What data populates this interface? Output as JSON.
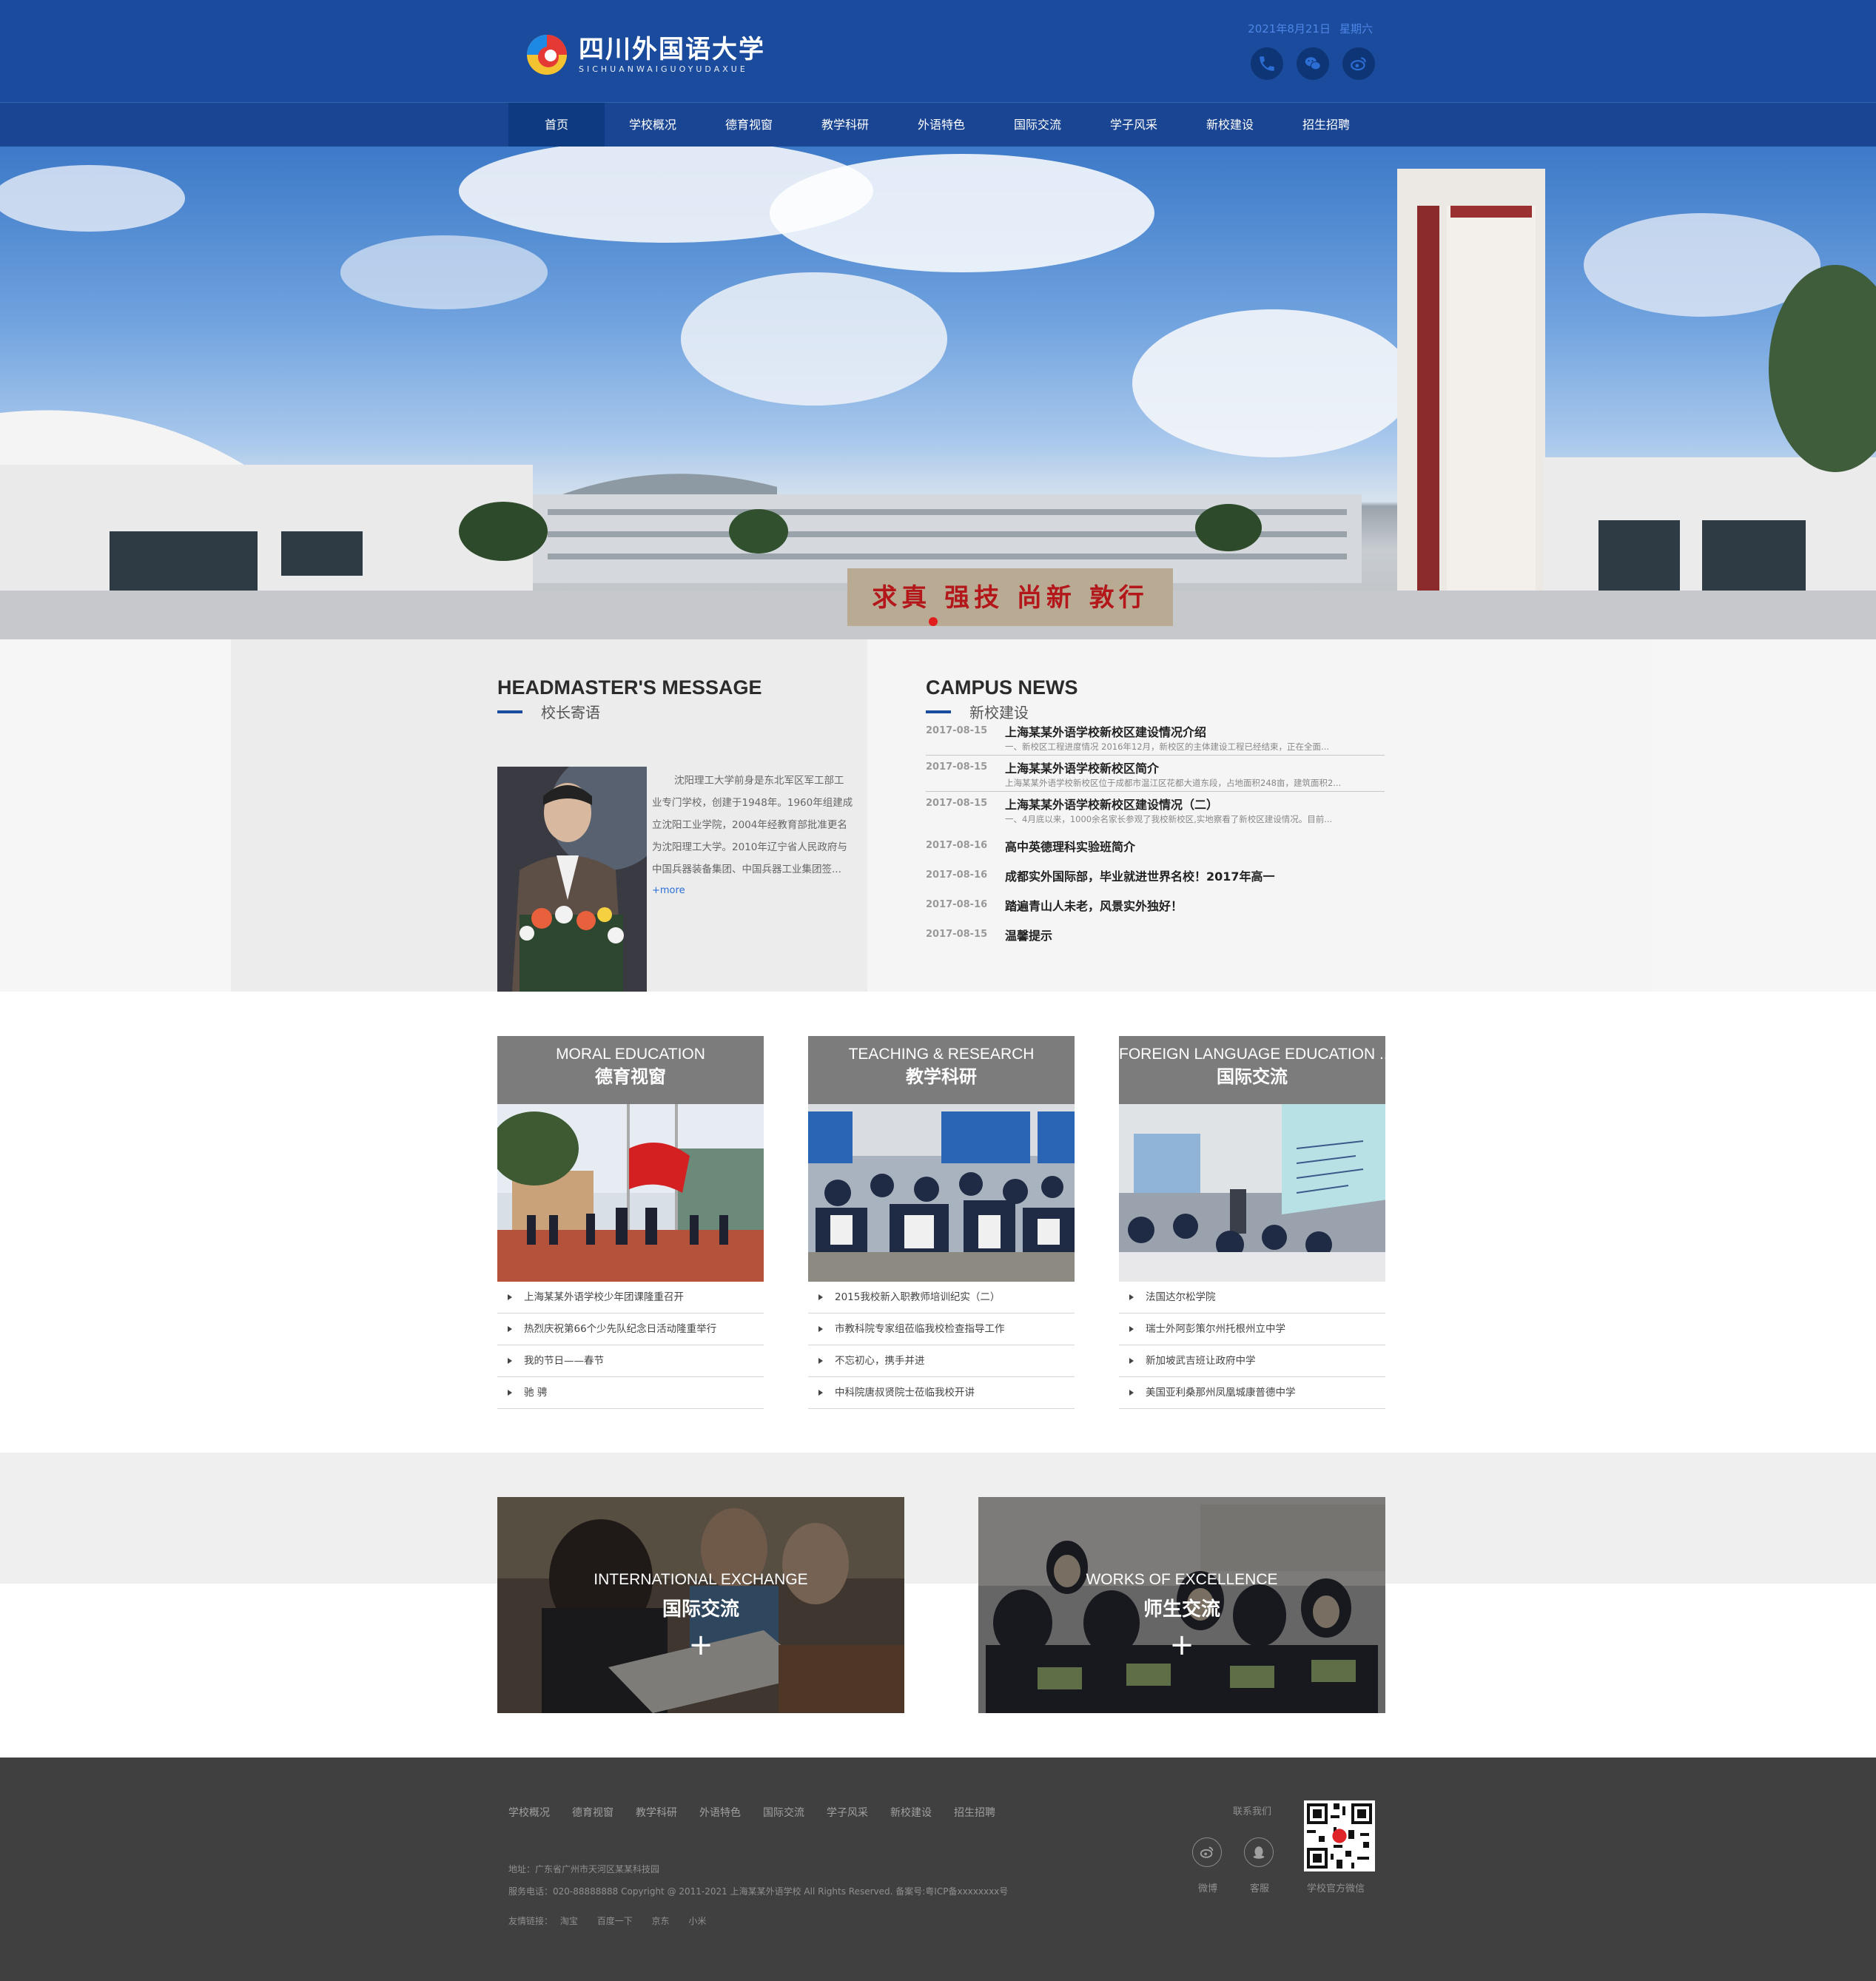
{
  "header": {
    "logo": {
      "cn": "四川外国语大学",
      "en": "SICHUANWAIGUOYUDAXUE"
    },
    "date": "2021年8月21日",
    "weekday": "星期六",
    "icons": [
      "phone-icon",
      "wechat-icon",
      "weibo-icon"
    ],
    "colors": {
      "header_bg": "#1b4b9c",
      "nav_bg": "#1a4593",
      "nav_active": "#0e3a82"
    }
  },
  "nav": {
    "items": [
      {
        "label": "首页",
        "active": true
      },
      {
        "label": "学校概况"
      },
      {
        "label": "德育视窗"
      },
      {
        "label": "教学科研"
      },
      {
        "label": "外语特色"
      },
      {
        "label": "国际交流"
      },
      {
        "label": "学子风采"
      },
      {
        "label": "新校建设"
      },
      {
        "label": "招生招聘"
      }
    ]
  },
  "hero": {
    "gate_sign": "求真 强技 尚新 敦行"
  },
  "headmaster": {
    "title_en": "HEADMASTER'S MESSAGE",
    "title_cn": "校长寄语",
    "text": "沈阳理工大学前身是东北军区军工部工业专门学校，创建于1948年。1960年组建成立沈阳工业学院，2004年经教育部批准更名为沈阳理工大学。2010年辽宁省人民政府与中国兵器装备集团、中国兵器工业集团签...",
    "more": "+more"
  },
  "news": {
    "title_en": "CAMPUS NEWS",
    "title_cn": "新校建设",
    "featured": [
      {
        "date": "2017-08-15",
        "title": "上海某某外语学校新校区建设情况介绍",
        "desc": "一、新校区工程进度情况 2016年12月，新校区的主体建设工程已经结束，正在全面..."
      },
      {
        "date": "2017-08-15",
        "title": "上海某某外语学校新校区简介",
        "desc": "上海某某外语学校新校区位于成都市温江区花都大道东段，占地面积248亩，建筑面积2..."
      },
      {
        "date": "2017-08-15",
        "title": "上海某某外语学校新校区建设情况（二）",
        "desc": "一、4月底以来，1000余名家长参观了我校新校区,实地察看了新校区建设情况。目前..."
      }
    ],
    "list": [
      {
        "date": "2017-08-16",
        "title": "高中英德理科实验班简介"
      },
      {
        "date": "2017-08-16",
        "title": "成都实外国际部，毕业就进世界名校！2017年高一"
      },
      {
        "date": "2017-08-16",
        "title": "踏遍青山人未老，风景实外独好！"
      },
      {
        "date": "2017-08-15",
        "title": "温馨提示"
      }
    ]
  },
  "columns": [
    {
      "en": "MORAL EDUCATION",
      "cn": "德育视窗",
      "items": [
        "上海某某外语学校少年团课隆重召开",
        "热烈庆祝第66个少先队纪念日活动隆重举行",
        "我的节日——春节",
        "驰 骋"
      ]
    },
    {
      "en": "TEACHING & RESEARCH",
      "cn": "教学科研",
      "items": [
        "2015我校新入职教师培训纪实（二）",
        "市教科院专家组莅临我校检查指导工作",
        "不忘初心，携手并进",
        "中科院唐叔贤院士莅临我校开讲"
      ]
    },
    {
      "en": "FOREIGN LANGUAGE EDUCATION ...",
      "cn": "国际交流",
      "items": [
        "法国达尔松学院",
        "瑞士外阿彭策尔州托根州立中学",
        "新加坡武吉班让政府中学",
        "美国亚利桑那州凤凰城康普德中学"
      ]
    }
  ],
  "exchange": [
    {
      "en": "INTERNATIONAL EXCHANGE",
      "cn": "国际交流",
      "plus": "+"
    },
    {
      "en": "WORKS OF EXCELLENCE",
      "cn": "师生交流",
      "plus": "+"
    }
  ],
  "footer": {
    "links": [
      "学校概况",
      "德育视窗",
      "教学科研",
      "外语特色",
      "国际交流",
      "学子风采",
      "新校建设",
      "招生招聘"
    ],
    "contact": "联系我们",
    "address": "地址：广东省广州市天河区某某科技园",
    "phone_line": "服务电话：020-88888888 Copyright @ 2011-2021 上海某某外语学校 All Rights Reserved.    备案号:粤ICP备xxxxxxxx号",
    "friends_label": "友情链接：",
    "friends": [
      "淘宝",
      "百度一下",
      "京东",
      "小米"
    ],
    "weibo_label": "微博",
    "service_label": "客服",
    "qr_label": "学校官方微信"
  }
}
